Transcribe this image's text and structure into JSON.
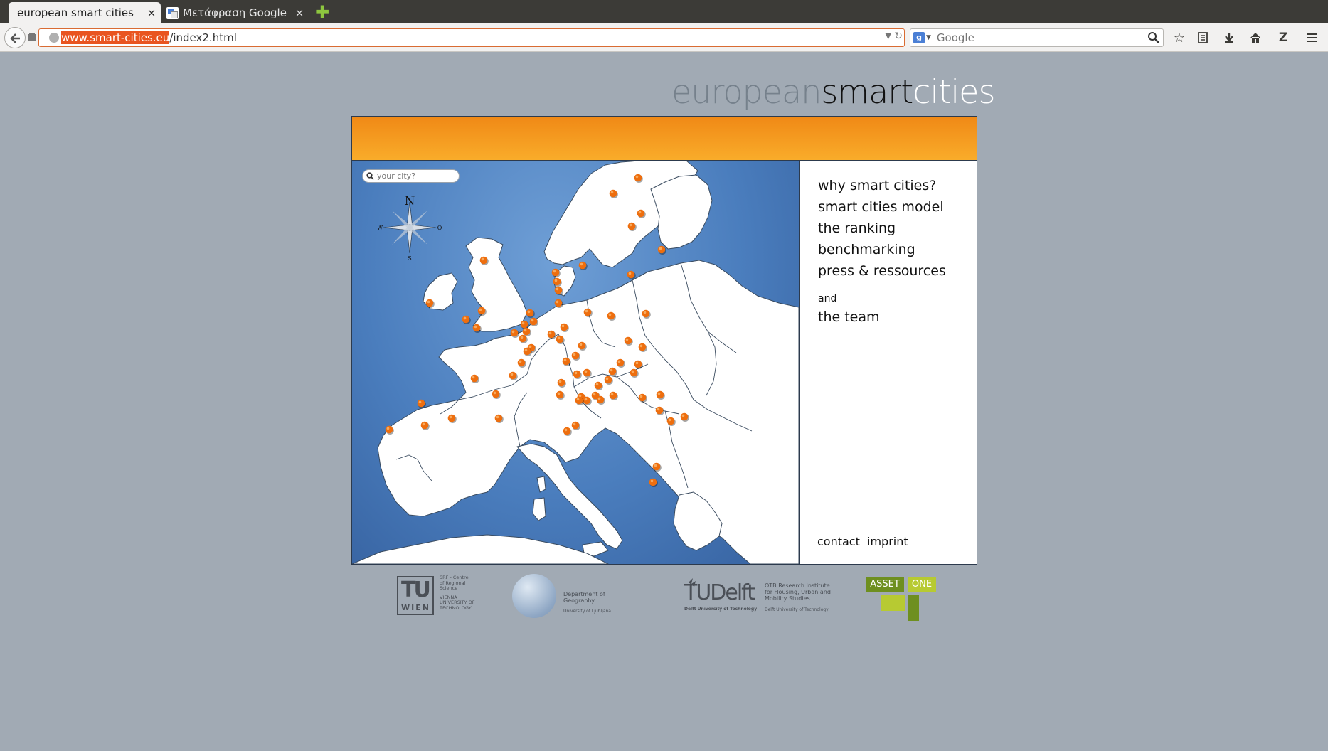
{
  "browser": {
    "tabs": [
      {
        "title": "european smart cities",
        "close": "×"
      },
      {
        "title": "Μετάφραση Google",
        "close": "×"
      }
    ],
    "new_tab": "✚",
    "url_host": "www.smart-cities.eu",
    "url_path": "/index2.html",
    "search_placeholder": "Google",
    "search_engine_icon": "g-icon"
  },
  "site": {
    "logo": {
      "part1": "european",
      "part2": "smart",
      "part3": "cities"
    },
    "city_search_placeholder": "your city?",
    "compass": {
      "n": "N",
      "s": "S",
      "w": "W",
      "o": "O"
    },
    "menu": [
      "why smart cities?",
      "smart cities model",
      "the ranking",
      "benchmarking",
      "press & ressources"
    ],
    "and_label": "and",
    "team_label": "the team",
    "footer_links": {
      "contact": "contact",
      "imprint": "imprint"
    }
  },
  "partners": {
    "tu_wien": {
      "tu": "TU",
      "wien": "WIEN",
      "text1": "SRF - Centre",
      "text2": "of Regional",
      "text3": "Science",
      "text4": "VIENNA",
      "text5": "UNIVERSITY OF",
      "text6": "TECHNOLOGY"
    },
    "ljubljana": {
      "line1": "Department of",
      "line2": "Geography",
      "sub": "University of Ljubljana"
    },
    "delft": {
      "logo": "TUDelft",
      "sub": "Delft University of Technology",
      "otb1": "OTB Research Institute",
      "otb2": "for Housing, Urban and",
      "otb3": "Mobility Studies",
      "otb_sub": "Delft University of Technology"
    },
    "asset_one": {
      "asset": "ASSET",
      "one": "ONE"
    }
  },
  "colors": {
    "page_bg": "#a1aab4",
    "header_orange": "#f39a1d",
    "sea_blue": "#4a7dbd",
    "city_dot": "#ee6e0e"
  },
  "map": {
    "city_count": 79
  }
}
